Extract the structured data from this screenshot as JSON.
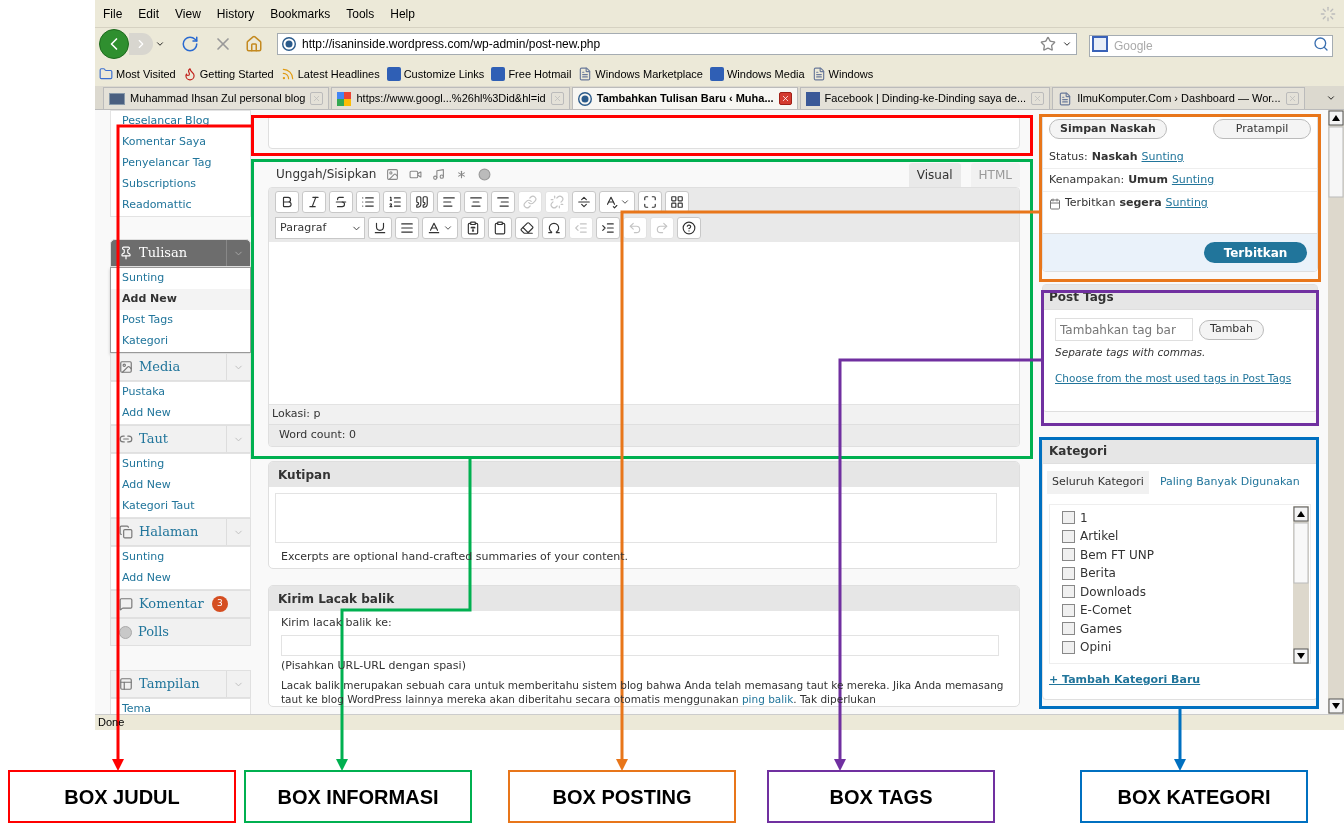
{
  "browser": {
    "menu": [
      "File",
      "Edit",
      "View",
      "History",
      "Bookmarks",
      "Tools",
      "Help"
    ],
    "url": "http://isaninside.wordpress.com/wp-admin/post-new.php",
    "search": {
      "placeholder": "Google"
    },
    "bookmarks": [
      {
        "kind": "folder",
        "label": "Most Visited"
      },
      {
        "kind": "start",
        "label": "Getting Started"
      },
      {
        "kind": "rss",
        "label": "Latest Headlines"
      },
      {
        "kind": "m",
        "label": "Customize Links"
      },
      {
        "kind": "m",
        "label": "Free Hotmail"
      },
      {
        "kind": "page",
        "label": "Windows Marketplace"
      },
      {
        "kind": "m",
        "label": "Windows Media"
      },
      {
        "kind": "page",
        "label": "Windows"
      }
    ],
    "tabs": [
      {
        "kind": "blog",
        "title": "Muhammad Ihsan Zul personal blog",
        "selected": false
      },
      {
        "kind": "google",
        "title": "https://www.googl...%26hl%3Did&hl=id",
        "selected": false
      },
      {
        "kind": "wordpress",
        "title": "Tambahkan Tulisan Baru ‹ Muha...",
        "selected": true
      },
      {
        "kind": "facebook",
        "title": "Facebook | Dinding-ke-Dinding saya de...",
        "selected": false
      },
      {
        "kind": "page",
        "title": "IlmuKomputer.Com › Dashboard — Wor...",
        "selected": false
      }
    ],
    "status": "Done"
  },
  "sidebar": {
    "groups": [
      {
        "kind": "list",
        "items": [
          {
            "label": "Peselancar Blog",
            "selected": false
          },
          {
            "label": "Komentar Saya",
            "selected": false
          },
          {
            "label": "Penyelancar Tag",
            "selected": false
          },
          {
            "label": "Subscriptions",
            "selected": false
          },
          {
            "label": "Readomattic",
            "selected": false
          }
        ]
      },
      {
        "kind": "posts",
        "header": "Tulisan",
        "current": true,
        "items": [
          {
            "label": "Sunting",
            "selected": false
          },
          {
            "label": "Add New",
            "selected": true
          },
          {
            "label": "Post Tags",
            "selected": false
          },
          {
            "label": "Kategori",
            "selected": false
          }
        ]
      },
      {
        "kind": "media",
        "header": "Media",
        "current": false,
        "items": [
          {
            "label": "Pustaka",
            "selected": false
          },
          {
            "label": "Add New",
            "selected": false
          }
        ]
      },
      {
        "kind": "links",
        "header": "Taut",
        "current": false,
        "items": [
          {
            "label": "Sunting",
            "selected": false
          },
          {
            "label": "Add New",
            "selected": false
          },
          {
            "label": "Kategori Taut",
            "selected": false
          }
        ]
      },
      {
        "kind": "pages",
        "header": "Halaman",
        "current": false,
        "items": [
          {
            "label": "Sunting",
            "selected": false
          },
          {
            "label": "Add New",
            "selected": false
          }
        ]
      },
      {
        "kind": "comments",
        "header": "Komentar",
        "badge": "3",
        "current": false
      },
      {
        "kind": "polls",
        "header": "Polls",
        "current": false
      },
      {
        "kind": "appearance",
        "header": "Tampilan",
        "current": false,
        "items": [
          {
            "label": "Tema",
            "selected": false
          }
        ]
      }
    ]
  },
  "editor": {
    "upload_label": "Unggah/Sisipkan",
    "modes": [
      {
        "label": "Visual",
        "selected": true
      },
      {
        "label": "HTML",
        "selected": false
      }
    ],
    "toolbar_row_1": [
      {
        "kind": "bold",
        "disabled": false
      },
      {
        "kind": "italic",
        "disabled": false
      },
      {
        "kind": "strike",
        "disabled": false
      },
      {
        "kind": "bullets",
        "disabled": false
      },
      {
        "kind": "numbers",
        "disabled": false
      },
      {
        "kind": "quote",
        "disabled": false
      },
      {
        "kind": "left",
        "disabled": false
      },
      {
        "kind": "center",
        "disabled": false
      },
      {
        "kind": "right",
        "disabled": false
      },
      {
        "kind": "link",
        "disabled": true
      },
      {
        "kind": "unlink",
        "disabled": true
      },
      {
        "kind": "more",
        "disabled": false
      },
      {
        "kind": "spell",
        "disabled": false
      },
      {
        "kind": "fullscreen",
        "disabled": false
      },
      {
        "kind": "sink",
        "disabled": false
      }
    ],
    "format": "Paragraf",
    "toolbar_row_2": [
      {
        "kind": "underline",
        "disabled": false
      },
      {
        "kind": "justify",
        "disabled": false
      },
      {
        "kind": "color",
        "disabled": false
      },
      {
        "kind": "pastetext",
        "disabled": false
      },
      {
        "kind": "pasteword",
        "disabled": false
      },
      {
        "kind": "erase",
        "disabled": false
      },
      {
        "kind": "omega",
        "disabled": false
      },
      {
        "kind": "outdent",
        "disabled": true
      },
      {
        "kind": "indent",
        "disabled": false
      },
      {
        "kind": "undo",
        "disabled": true
      },
      {
        "kind": "redo",
        "disabled": true
      },
      {
        "kind": "help",
        "disabled": false
      }
    ],
    "path": "Lokasi: p",
    "word_count": "Word count: 0"
  },
  "excerpt": {
    "title": "Kutipan",
    "hint": "Excerpts are optional hand-crafted summaries of your content."
  },
  "trackbacks": {
    "title": "Kirim Lacak balik",
    "label": "Kirim lacak balik ke:",
    "hint": "(Pisahkan URL-URL dengan spasi)",
    "text_before": "Lacak balik merupakan sebuah cara untuk memberitahu sistem blog bahwa Anda telah memasang taut ke mereka. Jika Anda memasang taut ke blog WordPress lainnya mereka akan diberitahu secara otomatis menggunakan",
    "link": "ping balik",
    "text_after": ". Tak diperlukan"
  },
  "publish": {
    "save": "Simpan Naskah",
    "preview": "Pratampil",
    "rows": [
      {
        "kind": "plain",
        "label": "Status:",
        "value": "Naskah",
        "link": "Sunting"
      },
      {
        "kind": "plain",
        "label": "Kenampakan:",
        "value": "Umum",
        "link": "Sunting"
      },
      {
        "kind": "date",
        "label": "Terbitkan",
        "value": "segera",
        "link": "Sunting"
      }
    ],
    "publish": "Terbitkan"
  },
  "tags": {
    "title": "Post Tags",
    "placeholder": "Tambahkan tag bar",
    "add": "Tambah",
    "hint": "Separate tags with commas.",
    "link": "Choose from the most used tags in Post Tags"
  },
  "categories": {
    "title": "Kategori",
    "tabs": [
      {
        "label": "Seluruh Kategori",
        "selected": true
      },
      {
        "label": "Paling Banyak Digunakan",
        "selected": false
      }
    ],
    "items": [
      {
        "label": "1",
        "checked": false
      },
      {
        "label": "Artikel",
        "checked": false
      },
      {
        "label": "Bem FT UNP",
        "checked": false
      },
      {
        "label": "Berita",
        "checked": false
      },
      {
        "label": "Downloads",
        "checked": false
      },
      {
        "label": "E-Comet",
        "checked": false
      },
      {
        "label": "Games",
        "checked": false
      },
      {
        "label": "Opini",
        "checked": false
      }
    ],
    "add": "+ Tambah Kategori Baru"
  },
  "annotations": [
    {
      "label": "BOX JUDUL",
      "color": "#ff0000"
    },
    {
      "label": "BOX INFORMASI",
      "color": "#00b050"
    },
    {
      "label": "BOX POSTING",
      "color": "#e8761a"
    },
    {
      "label": "BOX TAGS",
      "color": "#7030a0"
    },
    {
      "label": "BOX KATEGORI",
      "color": "#0070c0"
    }
  ]
}
